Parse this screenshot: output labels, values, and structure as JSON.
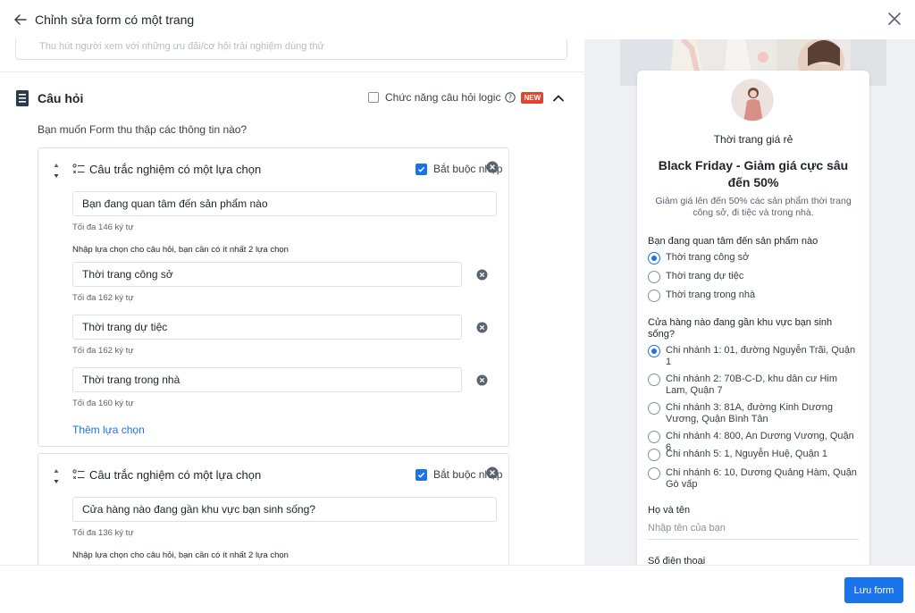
{
  "header": {
    "title": "Chỉnh sửa form có một trang"
  },
  "left": {
    "top_field_text": "Thu hút người xem với những ưu đãi/cơ hội trải nghiệm dùng thử",
    "section_title": "Câu hỏi",
    "logic_label": "Chức năng câu hỏi logic",
    "new_badge": "NEW",
    "intro": "Bạn muốn Form thu thập các thông tin nào?",
    "questions": [
      {
        "type_label": "Câu trắc nghiệm có một lựa chọn",
        "required_label": "Bắt buộc nhập",
        "text": "Bạn đang quan tâm đến sản phẩm nào",
        "text_hint": "Tối đa 146 ký tự",
        "options_note": "Nhập lựa chọn cho câu hỏi, bạn cần có ít nhất 2 lựa chọn",
        "options": [
          {
            "value": "Thời trang công sở",
            "hint": "Tối đa 162 ký tự"
          },
          {
            "value": "Thời trang dự tiệc",
            "hint": "Tối đa 162 ký tự"
          },
          {
            "value": "Thời trang trong nhà",
            "hint": "Tối đa 160 ký tự"
          }
        ],
        "add_option": "Thêm lựa chọn"
      },
      {
        "type_label": "Câu trắc nghiệm có một lựa chọn",
        "required_label": "Bắt buộc nhập",
        "text": "Cửa hàng nào đang gần khu vực bạn sinh sống?",
        "text_hint": "Tối đa 136 ký tự",
        "options_note": "Nhập lựa chọn cho câu hỏi, bạn cần có ít nhất 2 lựa chọn"
      }
    ]
  },
  "preview": {
    "brand": "Thời trang giá rẻ",
    "title": "Black Friday - Giảm giá cực sâu đến 50%",
    "description": "Giảm giá lên đến 50% các sản phẩm thời trang công sở, đi tiệc và trong nhà.",
    "q1": {
      "label": "Bạn đang quan tâm đến sản phẩm nào",
      "options": [
        "Thời trang công sở",
        "Thời trang dự tiệc",
        "Thời trang trong nhà"
      ]
    },
    "q2": {
      "label": "Cửa hàng nào đang gần khu vực bạn sinh sống?",
      "options": [
        "Chi nhánh 1: 01, đường Nguyễn Trãi, Quận 1",
        "Chi nhánh 2: 70B-C-D, khu dân cư Him Lam, Quận 7",
        "Chi nhánh 3: 81A, đường Kinh Dương Vương, Quận Bình Tân",
        "Chi nhánh 4: 800, An Dương Vương, Quận 6",
        "Chi nhánh 5: 1, Nguyễn Huệ, Quận 1",
        "Chi nhánh 6: 10, Dương Quảng Hàm, Quận Gò vấp"
      ]
    },
    "name_label": "Họ và tên",
    "name_placeholder": "Nhập tên của bạn",
    "phone_label": "Số điện thoại"
  },
  "footer": {
    "save_label": "Lưu form"
  },
  "colors": {
    "accent": "#1a73e8",
    "badge": "#e0442f"
  }
}
